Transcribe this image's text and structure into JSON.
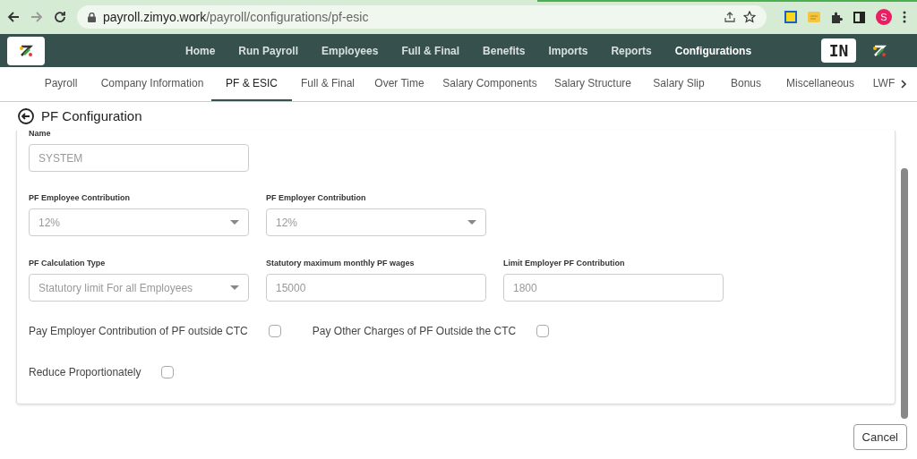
{
  "browser": {
    "url_host": "payroll.zimyo.work",
    "url_path": "/payroll/configurations/pf-esic",
    "profile_initial": "S"
  },
  "nav": {
    "items": [
      {
        "label": "Home",
        "selected": false
      },
      {
        "label": "Run Payroll",
        "selected": false
      },
      {
        "label": "Employees",
        "selected": false
      },
      {
        "label": "Full & Final",
        "selected": false
      },
      {
        "label": "Benefits",
        "selected": false
      },
      {
        "label": "Imports",
        "selected": false
      },
      {
        "label": "Reports",
        "selected": false
      },
      {
        "label": "Configurations",
        "selected": true
      }
    ],
    "badge": "IN"
  },
  "tabs": [
    {
      "label": "Payroll",
      "selected": false
    },
    {
      "label": "Company Information",
      "selected": false
    },
    {
      "label": "PF & ESIC",
      "selected": true
    },
    {
      "label": "Full & Final",
      "selected": false
    },
    {
      "label": "Over Time",
      "selected": false
    },
    {
      "label": "Salary Components",
      "selected": false
    },
    {
      "label": "Salary Structure",
      "selected": false
    },
    {
      "label": "Salary Slip",
      "selected": false
    },
    {
      "label": "Bonus",
      "selected": false
    },
    {
      "label": "Miscellaneous",
      "selected": false
    },
    {
      "label": "LWF",
      "selected": false
    }
  ],
  "page_title": "PF Configuration",
  "field_rows": [
    [
      {
        "label": "Name",
        "kind": "text",
        "value": "SYSTEM"
      }
    ],
    [
      {
        "label": "PF Employee Contribution",
        "kind": "select",
        "value": "12%"
      },
      {
        "label": "PF Employer Contribution",
        "kind": "select",
        "value": "12%"
      }
    ],
    [
      {
        "label": "PF Calculation Type",
        "kind": "select",
        "value": "Statutory limit For all Employees"
      },
      {
        "label": "Statutory maximum monthly PF wages",
        "kind": "text",
        "value": "15000"
      },
      {
        "label": "Limit Employer PF Contribution",
        "kind": "text",
        "value": "1800"
      }
    ]
  ],
  "checkbox_rows": [
    [
      {
        "label": "Pay Employer Contribution of PF outside CTC",
        "checked": false
      },
      {
        "label": "Pay Other Charges of PF Outside the CTC",
        "checked": false
      }
    ],
    [
      {
        "label": "Reduce Proportionately",
        "checked": false
      }
    ]
  ],
  "buttons": [
    "Cancel"
  ]
}
